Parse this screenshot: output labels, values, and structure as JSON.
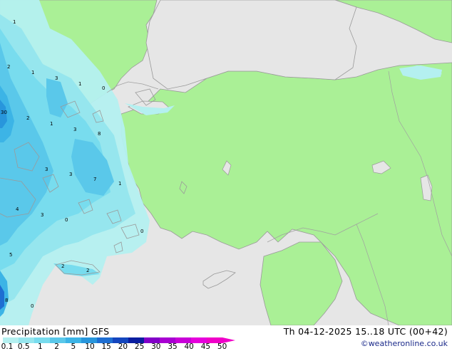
{
  "footer": {
    "title": "Precipitation [mm] GFS",
    "datetime": "Th 04-12-2025 15..18 UTC (00+42)",
    "credit": "©weatheronline.co.uk"
  },
  "legend": {
    "ticks": [
      "0.1",
      "0.5",
      "1",
      "2",
      "5",
      "10",
      "15",
      "20",
      "25",
      "30",
      "35",
      "40",
      "45",
      "50"
    ],
    "colors": [
      "#b4f0f0",
      "#96e6ee",
      "#78dcee",
      "#5ac8ea",
      "#3cb4e6",
      "#2896dc",
      "#1e6ed2",
      "#1446be",
      "#0a1ea0",
      "#8200c8",
      "#a800d2",
      "#c800d8",
      "#e600dc",
      "#f000c8"
    ]
  },
  "map": {
    "land_color": "#aaf096",
    "sea_color": "#e6e6e6",
    "value_labels": [
      "1",
      "2",
      "1",
      "3",
      "1",
      "0",
      "30",
      "2",
      "1",
      "3",
      "8",
      "3",
      "3",
      "7",
      "1",
      "4",
      "3",
      "0",
      "0",
      "5",
      "2",
      "2",
      "8",
      "0"
    ]
  }
}
